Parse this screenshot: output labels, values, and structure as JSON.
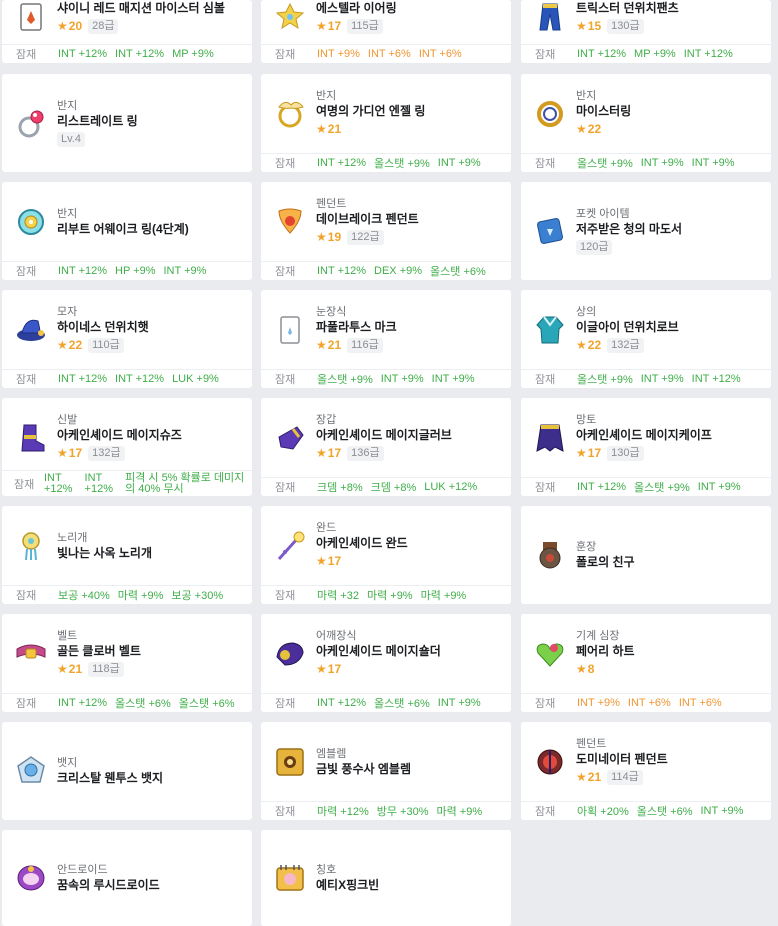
{
  "potential_label": "잠재",
  "colors": {
    "rare_option": "#3fae49",
    "epic_option": "#f09532",
    "star": "#f2a32c"
  },
  "rows": [
    [
      {
        "category": "",
        "name": "샤이니 레드 매지션 마이스터 심볼",
        "star": "20",
        "level": "28급",
        "icon": "symbol-icon",
        "potential": [
          {
            "text": "INT +12%",
            "tier": "g"
          },
          {
            "text": "INT +12%",
            "tier": "g"
          },
          {
            "text": "MP +9%",
            "tier": "g"
          }
        ]
      },
      {
        "category": "",
        "name": "에스텔라 이어링",
        "star": "17",
        "level": "115급",
        "icon": "earring-icon",
        "potential": [
          {
            "text": "INT +9%",
            "tier": "o"
          },
          {
            "text": "INT +6%",
            "tier": "o"
          },
          {
            "text": "INT +6%",
            "tier": "o"
          }
        ]
      },
      {
        "category": "",
        "name": "트릭스터 던위치팬츠",
        "star": "15",
        "level": "130급",
        "icon": "pants-icon",
        "potential": [
          {
            "text": "INT +12%",
            "tier": "g"
          },
          {
            "text": "MP +9%",
            "tier": "g"
          },
          {
            "text": "INT +12%",
            "tier": "g"
          }
        ]
      }
    ],
    [
      {
        "category": "반지",
        "name": "리스트레이트 링",
        "star": "",
        "level": "Lv.4",
        "icon": "ring-icon",
        "potential": []
      },
      {
        "category": "반지",
        "name": "여명의 가디언 엔젤 링",
        "star": "21",
        "level": "",
        "icon": "angel-ring-icon",
        "potential": [
          {
            "text": "INT +12%",
            "tier": "g"
          },
          {
            "text": "올스탯 +9%",
            "tier": "g"
          },
          {
            "text": "INT +9%",
            "tier": "g"
          }
        ]
      },
      {
        "category": "반지",
        "name": "마이스터링",
        "star": "22",
        "level": "",
        "icon": "meister-ring-icon",
        "potential": [
          {
            "text": "올스탯 +9%",
            "tier": "g"
          },
          {
            "text": "INT +9%",
            "tier": "g"
          },
          {
            "text": "INT +9%",
            "tier": "g"
          }
        ]
      }
    ],
    [
      {
        "category": "반지",
        "name": "리부트 어웨이크 링(4단계)",
        "star": "",
        "level": "",
        "icon": "awake-ring-icon",
        "potential": [
          {
            "text": "INT +12%",
            "tier": "g"
          },
          {
            "text": "HP +9%",
            "tier": "g"
          },
          {
            "text": "INT +9%",
            "tier": "g"
          }
        ]
      },
      {
        "category": "펜던트",
        "name": "데이브레이크 펜던트",
        "star": "19",
        "level": "122급",
        "icon": "pendant-icon",
        "potential": [
          {
            "text": "INT +12%",
            "tier": "g"
          },
          {
            "text": "DEX +9%",
            "tier": "g"
          },
          {
            "text": "올스탯 +6%",
            "tier": "g"
          }
        ]
      },
      {
        "category": "포켓 아이템",
        "name": "저주받은 청의 마도서",
        "star": "",
        "level": "120급",
        "icon": "grimoire-icon",
        "potential": []
      }
    ],
    [
      {
        "category": "모자",
        "name": "하이네스 던위치햇",
        "star": "22",
        "level": "110급",
        "icon": "hat-icon",
        "potential": [
          {
            "text": "INT +12%",
            "tier": "g"
          },
          {
            "text": "INT +12%",
            "tier": "g"
          },
          {
            "text": "LUK +9%",
            "tier": "g"
          }
        ]
      },
      {
        "category": "눈장식",
        "name": "파풀라투스 마크",
        "star": "21",
        "level": "116급",
        "icon": "eye-accessory-icon",
        "potential": [
          {
            "text": "올스탯 +9%",
            "tier": "g"
          },
          {
            "text": "INT +9%",
            "tier": "g"
          },
          {
            "text": "INT +9%",
            "tier": "g"
          }
        ]
      },
      {
        "category": "상의",
        "name": "이글아이 던위치로브",
        "star": "22",
        "level": "132급",
        "icon": "robe-icon",
        "potential": [
          {
            "text": "올스탯 +9%",
            "tier": "g"
          },
          {
            "text": "INT +9%",
            "tier": "g"
          },
          {
            "text": "INT +12%",
            "tier": "g"
          }
        ]
      }
    ],
    [
      {
        "category": "신발",
        "name": "아케인셰이드 메이지슈즈",
        "star": "17",
        "level": "132급",
        "icon": "shoes-icon",
        "potential": [
          {
            "text": "INT +12%",
            "tier": "g"
          },
          {
            "text": "INT +12%",
            "tier": "g"
          },
          {
            "text": "피격 시 5% 확률로 데미지의 40% 무시",
            "tier": "g"
          }
        ]
      },
      {
        "category": "장갑",
        "name": "아케인셰이드 메이지글러브",
        "star": "17",
        "level": "136급",
        "icon": "glove-icon",
        "potential": [
          {
            "text": "크뎀 +8%",
            "tier": "g"
          },
          {
            "text": "크뎀 +8%",
            "tier": "g"
          },
          {
            "text": "LUK +12%",
            "tier": "g"
          }
        ]
      },
      {
        "category": "망토",
        "name": "아케인셰이드 메이지케이프",
        "star": "17",
        "level": "130급",
        "icon": "cape-icon",
        "potential": [
          {
            "text": "INT +12%",
            "tier": "g"
          },
          {
            "text": "올스탯 +9%",
            "tier": "g"
          },
          {
            "text": "INT +9%",
            "tier": "g"
          }
        ]
      }
    ],
    [
      {
        "category": "노리개",
        "name": "빛나는 사옥 노리개",
        "star": "",
        "level": "",
        "icon": "norigae-icon",
        "potential": [
          {
            "text": "보공 +40%",
            "tier": "g"
          },
          {
            "text": "마력 +9%",
            "tier": "g"
          },
          {
            "text": "보공 +30%",
            "tier": "g"
          }
        ]
      },
      {
        "category": "완드",
        "name": "아케인셰이드 완드",
        "star": "17",
        "level": "",
        "icon": "wand-icon",
        "potential": [
          {
            "text": "마력 +32",
            "tier": "g"
          },
          {
            "text": "마력 +9%",
            "tier": "g"
          },
          {
            "text": "마력 +9%",
            "tier": "g"
          }
        ]
      },
      {
        "category": "훈장",
        "name": "폴로의 친구",
        "star": "",
        "level": "",
        "icon": "medal-icon",
        "potential": []
      }
    ],
    [
      {
        "category": "벨트",
        "name": "골든 클로버 벨트",
        "star": "21",
        "level": "118급",
        "icon": "belt-icon",
        "potential": [
          {
            "text": "INT +12%",
            "tier": "g"
          },
          {
            "text": "올스탯 +6%",
            "tier": "g"
          },
          {
            "text": "올스탯 +6%",
            "tier": "g"
          }
        ]
      },
      {
        "category": "어깨장식",
        "name": "아케인셰이드 메이지숄더",
        "star": "17",
        "level": "",
        "icon": "shoulder-icon",
        "potential": [
          {
            "text": "INT +12%",
            "tier": "g"
          },
          {
            "text": "올스탯 +6%",
            "tier": "g"
          },
          {
            "text": "INT +9%",
            "tier": "g"
          }
        ]
      },
      {
        "category": "기계 심장",
        "name": "페어리 하트",
        "star": "8",
        "level": "",
        "icon": "heart-icon",
        "potential": [
          {
            "text": "INT +9%",
            "tier": "o"
          },
          {
            "text": "INT +6%",
            "tier": "o"
          },
          {
            "text": "INT +6%",
            "tier": "o"
          }
        ]
      }
    ],
    [
      {
        "category": "뱃지",
        "name": "크리스탈 웬투스 뱃지",
        "star": "",
        "level": "",
        "icon": "badge-icon",
        "potential": []
      },
      {
        "category": "엠블렘",
        "name": "금빛 풍수사 엠블렘",
        "star": "",
        "level": "",
        "icon": "emblem-icon",
        "potential": [
          {
            "text": "마력 +12%",
            "tier": "g"
          },
          {
            "text": "방무 +30%",
            "tier": "g"
          },
          {
            "text": "마력 +9%",
            "tier": "g"
          }
        ]
      },
      {
        "category": "펜던트",
        "name": "도미네이터 펜던트",
        "star": "21",
        "level": "114급",
        "icon": "dominator-icon",
        "potential": [
          {
            "text": "아획 +20%",
            "tier": "g"
          },
          {
            "text": "올스탯 +6%",
            "tier": "g"
          },
          {
            "text": "INT +9%",
            "tier": "g"
          }
        ]
      }
    ],
    [
      {
        "category": "안드로이드",
        "name": "꿈속의 루시드로이드",
        "star": "",
        "level": "",
        "icon": "android-icon",
        "potential": []
      },
      {
        "category": "칭호",
        "name": "예티X핑크빈",
        "star": "",
        "level": "",
        "icon": "title-icon",
        "potential": []
      }
    ]
  ]
}
